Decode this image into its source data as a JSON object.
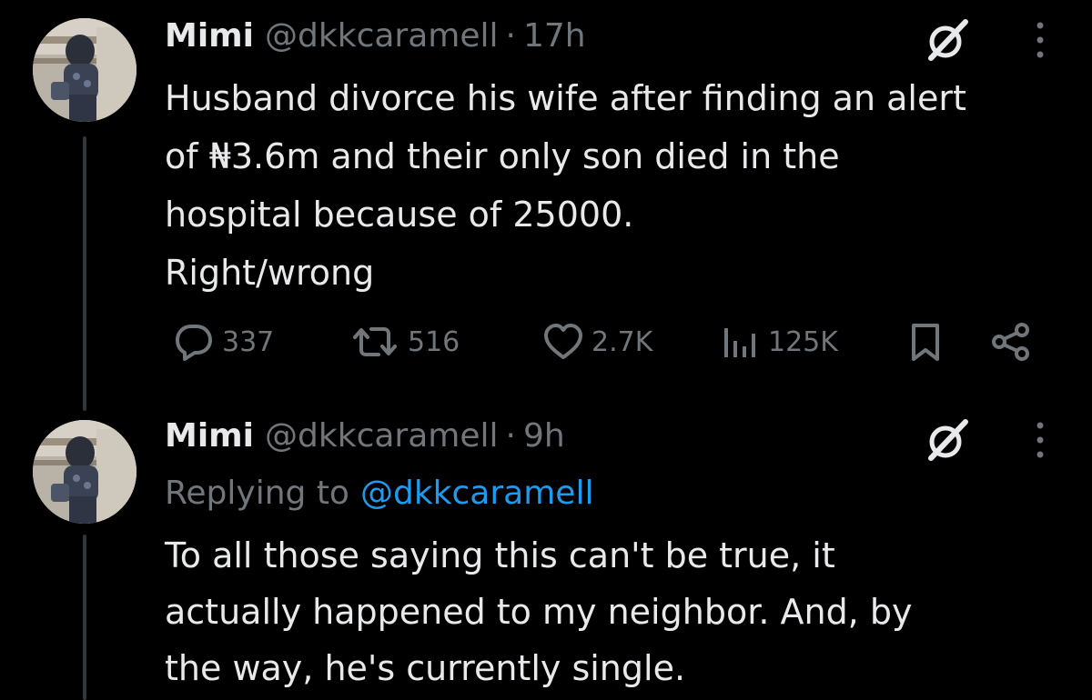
{
  "tweets": [
    {
      "name": "Mimi",
      "handle": "@dkkcaramell",
      "separator": "·",
      "time": "17h",
      "text": "Husband divorce his wife after finding an alert\nof ₦3.6m and their only son died in the\nhospital because of 25000.\nRight/wrong",
      "metrics": {
        "replies": "337",
        "reposts": "516",
        "likes": "2.7K",
        "views": "125K"
      }
    },
    {
      "name": "Mimi",
      "handle": "@dkkcaramell",
      "separator": "·",
      "time": "9h",
      "replying_prefix": "Replying to",
      "replying_to": "@dkkcaramell",
      "text": "To all those saying this can't be true, it\nactually happened to my neighbor. And, by\nthe way, he's currently single."
    }
  ],
  "icons": {
    "reply": "reply-icon",
    "repost": "repost-icon",
    "like": "heart-icon",
    "views": "views-icon",
    "bookmark": "bookmark-icon",
    "share": "share-icon",
    "grok": "grok-icon",
    "more": "more-icon"
  },
  "colors": {
    "background": "#000000",
    "text": "#e7e9ea",
    "muted": "#71767b",
    "link": "#1d9bf0",
    "thread_line": "#333639"
  }
}
